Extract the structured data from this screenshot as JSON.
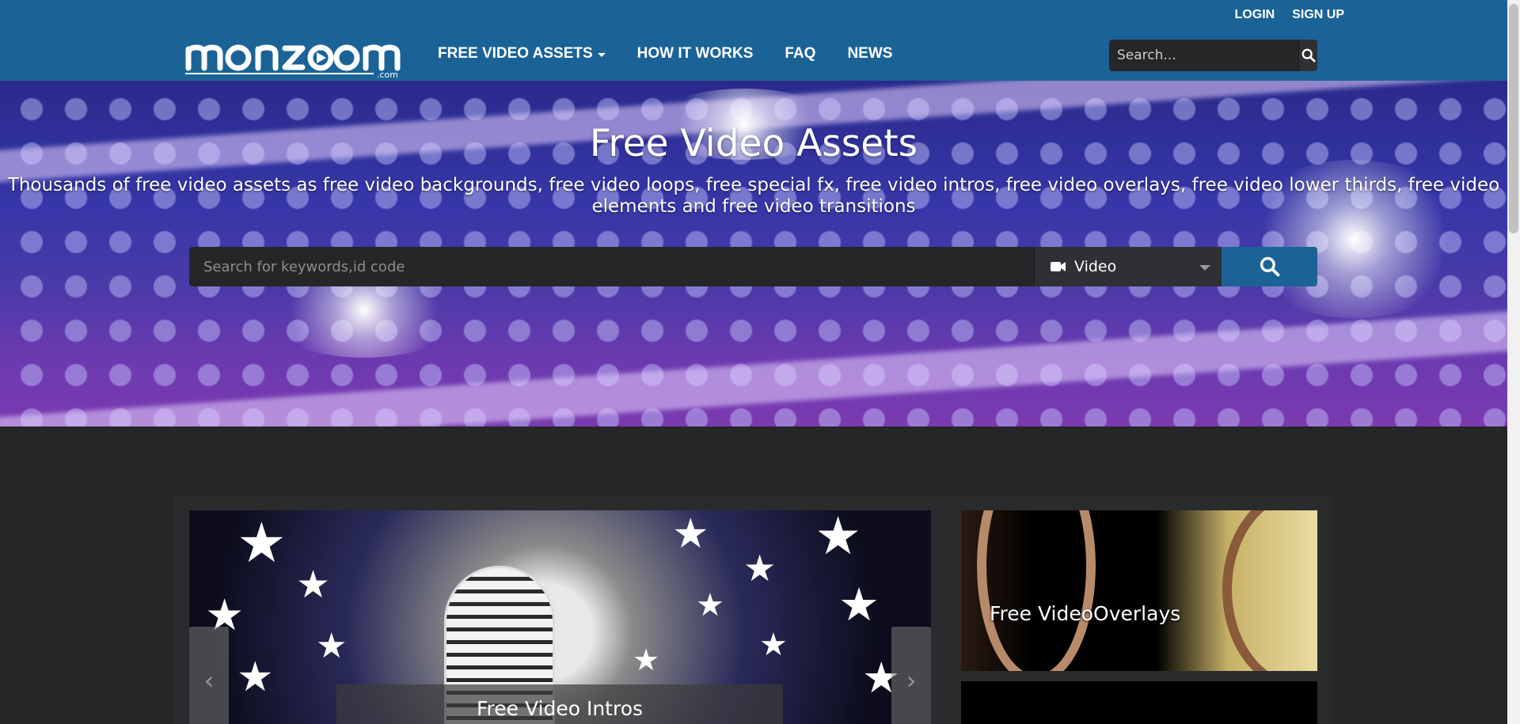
{
  "header": {
    "top_links": {
      "login": "LOGIN",
      "signup": "SIGN UP"
    },
    "logo": {
      "text": "monzoom",
      "tld": ".com"
    },
    "nav": [
      {
        "label": "FREE VIDEO ASSETS",
        "dropdown": true
      },
      {
        "label": "HOW IT WORKS"
      },
      {
        "label": "FAQ"
      },
      {
        "label": "NEWS"
      }
    ],
    "search": {
      "placeholder": "Search..."
    }
  },
  "hero": {
    "title": "Free Video Assets",
    "subtitle": "Thousands of free video assets as free video backgrounds, free video loops, free special fx, free video intros, free video overlays, free video lower thirds, free video elements and free video transitions",
    "search": {
      "placeholder": "Search for keywords,id code",
      "type_selected": "Video"
    }
  },
  "featured": {
    "intros_caption": "Free Video Intros",
    "overlays_caption": "Free VideoOverlays"
  },
  "colors": {
    "brand": "#1b6397",
    "background": "#252628",
    "search_bg": "#252628"
  },
  "icons": [
    "search-icon",
    "video-camera-icon",
    "chevron-left-icon",
    "chevron-right-icon",
    "caret-down-icon"
  ]
}
